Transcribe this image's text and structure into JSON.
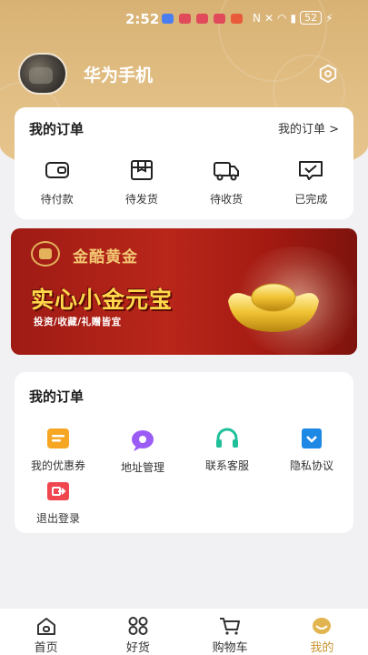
{
  "status_bar": {
    "time": "2:52",
    "battery": "52"
  },
  "profile": {
    "username": "华为手机"
  },
  "orders_card": {
    "title": "我的订单",
    "more": "我的订单 >",
    "items": [
      {
        "label": "待付款",
        "icon": "wallet-icon"
      },
      {
        "label": "待发货",
        "icon": "package-icon"
      },
      {
        "label": "待收货",
        "icon": "truck-icon"
      },
      {
        "label": "已完成",
        "icon": "completed-icon"
      }
    ]
  },
  "banner": {
    "brand": "金酷黄金",
    "headline": "实心小金元宝",
    "subtitle": "投资/收藏/礼赠皆宜"
  },
  "services_card": {
    "title": "我的订单",
    "items": [
      {
        "label": "我的优惠券",
        "icon": "coupon-icon",
        "color": "#f6a623"
      },
      {
        "label": "地址管理",
        "icon": "location-icon",
        "color": "#9b5cf6"
      },
      {
        "label": "联系客服",
        "icon": "headset-icon",
        "color": "#1fbf9a"
      },
      {
        "label": "隐私协议",
        "icon": "privacy-icon",
        "color": "#1e88e5"
      },
      {
        "label": "退出登录",
        "icon": "logout-icon",
        "color": "#f0464f"
      }
    ]
  },
  "tabbar": {
    "tabs": [
      {
        "label": "首页",
        "icon": "home-icon"
      },
      {
        "label": "好货",
        "icon": "grid-icon"
      },
      {
        "label": "购物车",
        "icon": "cart-icon"
      },
      {
        "label": "我的",
        "icon": "profile-icon",
        "active": true
      }
    ]
  },
  "colors": {
    "header": "#dcb67a",
    "accent": "#c9942d",
    "banner_red": "#a81d15",
    "gold": "#ffd84a"
  }
}
